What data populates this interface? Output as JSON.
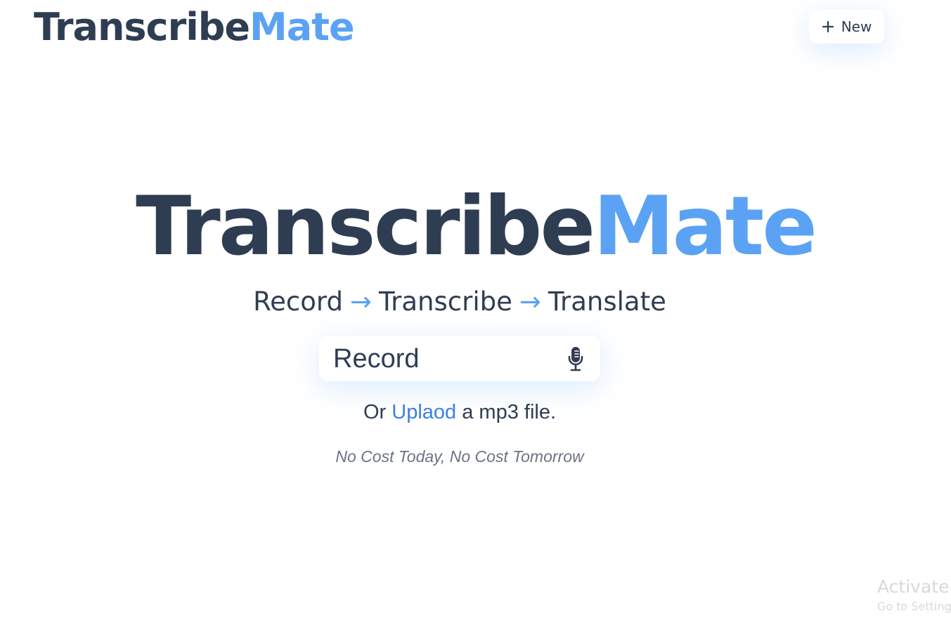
{
  "header": {
    "logo": {
      "prefix": "Transcribe",
      "suffix": "Mate"
    },
    "new_button": {
      "label": "New",
      "icon": "plus-icon"
    }
  },
  "hero": {
    "title": {
      "prefix": "Transcribe",
      "suffix": "Mate"
    },
    "steps": [
      "Record",
      "Transcribe",
      "Translate"
    ],
    "arrow": "→",
    "record_button": {
      "label": "Record",
      "icon": "microphone-icon"
    },
    "upload_prompt": {
      "before": "Or ",
      "link": "Uplaod",
      "after": " a mp3 file."
    },
    "tagline": "No Cost Today, No Cost Tomorrow"
  },
  "system_overlay": {
    "title": "Activate W",
    "subtitle": "Go to Setting"
  },
  "theme": {
    "dark_text": "#2f3d52",
    "accent_blue": "#5ba2f4",
    "link_blue": "#3c80e4"
  }
}
